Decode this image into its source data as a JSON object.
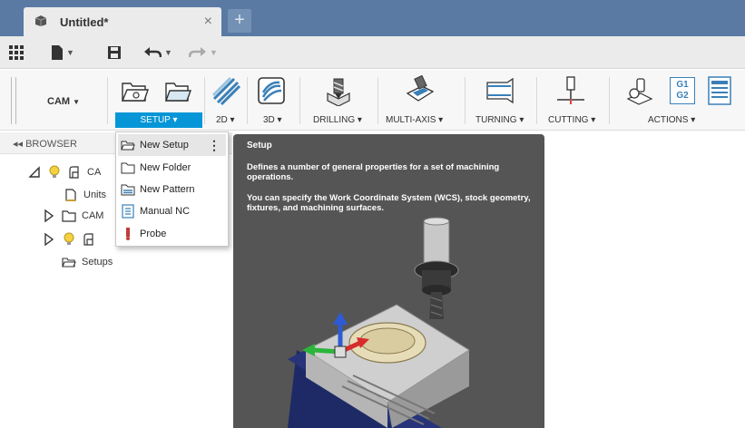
{
  "tab": {
    "title": "Untitled*",
    "close": "×",
    "plus": "+"
  },
  "workspace": {
    "label": "CAM",
    "caret": "▼"
  },
  "ribbon": {
    "setup": "SETUP ▾",
    "two_d": "2D ▾",
    "three_d": "3D ▾",
    "drilling": "DRILLING ▾",
    "multi_axis": "MULTI-AXIS ▾",
    "turning": "TURNING ▾",
    "cutting": "CUTTING ▾",
    "actions": "ACTIONS ▾",
    "g1g2": {
      "line1": "G1",
      "line2": "G2"
    }
  },
  "browser": {
    "header": "◂◂ BROWSER",
    "rows": [
      "CA",
      "Units",
      "CAM",
      "",
      "Setups"
    ]
  },
  "dropdown": {
    "items": [
      "New Setup",
      "New Folder",
      "New Pattern",
      "Manual NC",
      "Probe"
    ],
    "more": "⋮"
  },
  "tooltip": {
    "title": "Setup",
    "p1": "Defines a number of general properties for a set of machining operations.",
    "p2": "You can specify the Work Coordinate System (WCS), stock geometry, fixtures, and machining surfaces."
  },
  "colors": {
    "tabbar": "#5a7aa4",
    "accent": "#0696d7",
    "tooltip_bg": "#555555"
  }
}
